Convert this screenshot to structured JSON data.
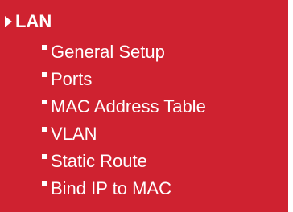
{
  "menu": {
    "section_label": "LAN",
    "section_icon": "arrow-right-icon",
    "bullet_icon": "square-bullet-icon",
    "background_color": "#cf2230",
    "text_color": "#ffffff",
    "items": [
      {
        "label": "General Setup"
      },
      {
        "label": "Ports"
      },
      {
        "label": "MAC Address Table"
      },
      {
        "label": "VLAN"
      },
      {
        "label": "Static Route"
      },
      {
        "label": "Bind IP to MAC"
      }
    ]
  }
}
